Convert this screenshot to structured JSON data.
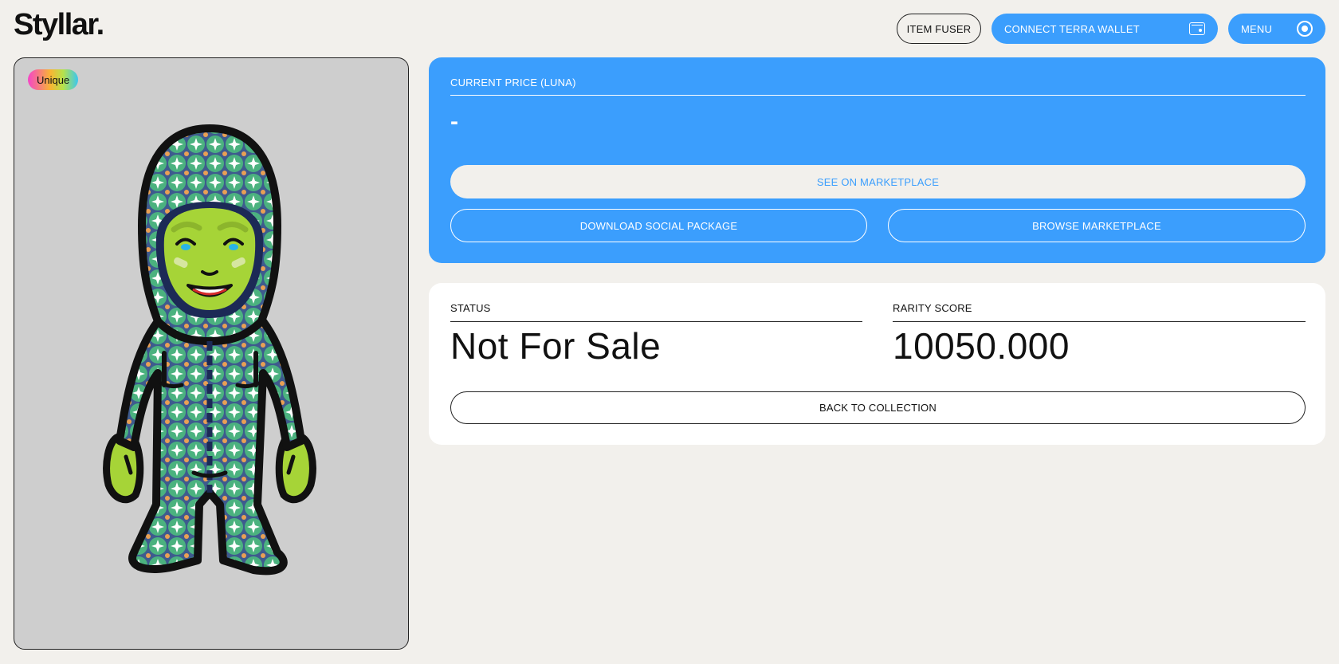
{
  "header": {
    "logo": "Styllar",
    "logo_dot": ".",
    "item_fuser_label": "ITEM FUSER",
    "connect_wallet_label": "CONNECT TERRA WALLET",
    "menu_label": "MENU"
  },
  "artwork": {
    "badge": "Unique"
  },
  "price": {
    "label": "CURRENT PRICE (LUNA)",
    "value": "-",
    "see_marketplace_label": "SEE ON MARKETPLACE",
    "download_label": "DOWNLOAD SOCIAL PACKAGE",
    "browse_label": "BROWSE MARKETPLACE"
  },
  "status": {
    "status_label": "STATUS",
    "status_value": "Not For Sale",
    "rarity_label": "RARITY SCORE",
    "rarity_value": "10050.000",
    "back_label": "BACK TO COLLECTION"
  },
  "colors": {
    "accent_blue": "#3b9efd",
    "background": "#f2f0ec",
    "card_gray": "#cecece"
  }
}
